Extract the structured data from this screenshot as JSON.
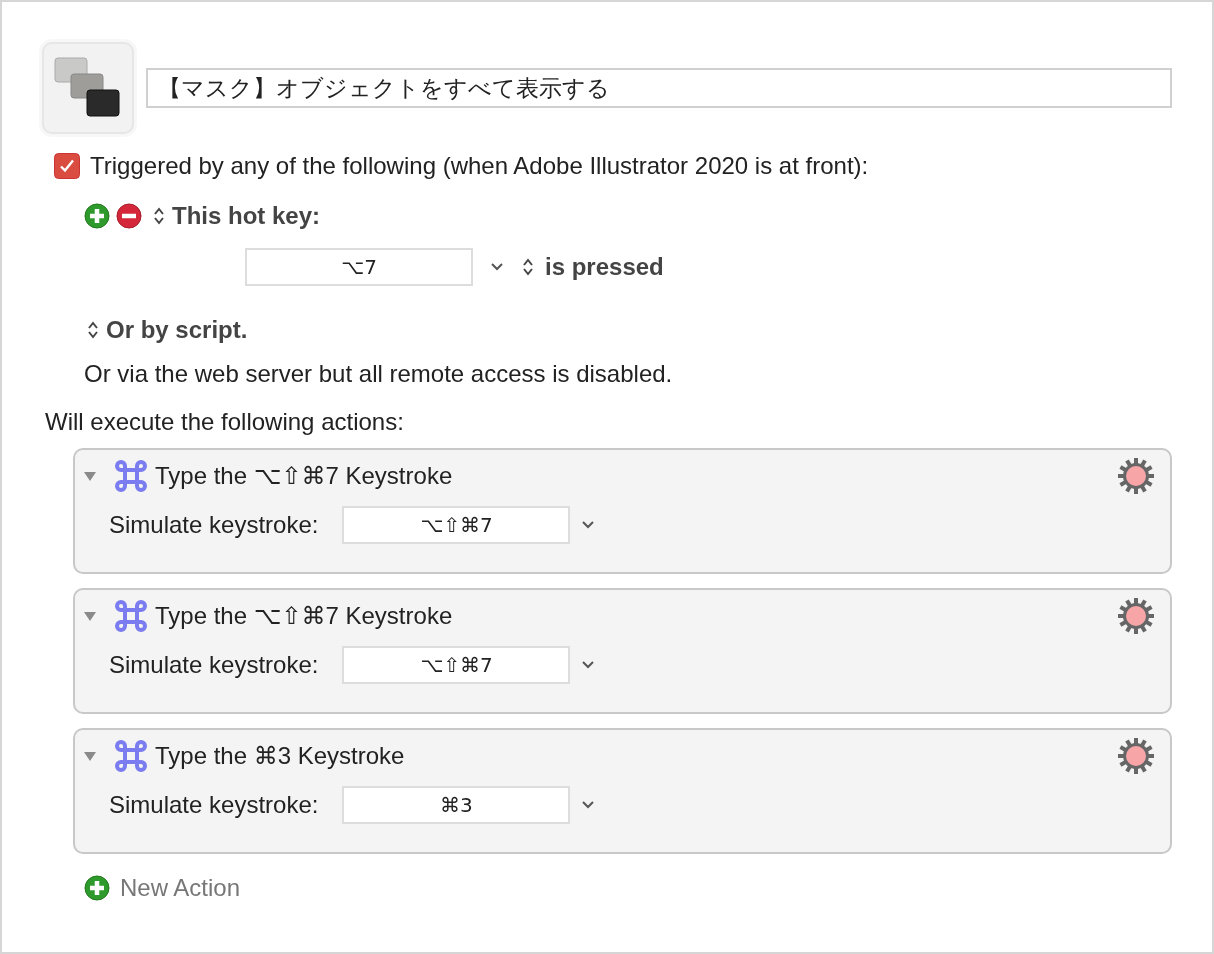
{
  "macro": {
    "title": "【マスク】オブジェクトをすべて表示する"
  },
  "trigger": {
    "checked": true,
    "label": "Triggered by any of the following (when Adobe Illustrator 2020 is at front):",
    "hotkey_label": "This hot key:",
    "hotkey": "⌥7",
    "hotkey_condition": "is pressed",
    "script_label": "Or by script.",
    "web_note": "Or via the web server but all remote access is disabled."
  },
  "actions_heading": "Will execute the following actions:",
  "actions": [
    {
      "title": "Type the ⌥⇧⌘7 Keystroke",
      "expanded": true,
      "field_label": "Simulate keystroke:",
      "keystroke": "⌥⇧⌘7"
    },
    {
      "title": "Type the ⌥⇧⌘7 Keystroke",
      "expanded": true,
      "field_label": "Simulate keystroke:",
      "keystroke": "⌥⇧⌘7"
    },
    {
      "title": "Type the ⌘3 Keystroke",
      "expanded": true,
      "field_label": "Simulate keystroke:",
      "keystroke": "⌘3"
    }
  ],
  "new_action": "New Action"
}
